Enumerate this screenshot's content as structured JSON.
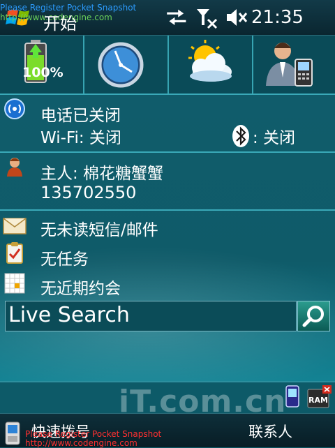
{
  "topbar": {
    "start_label": "开始",
    "time": "21:35",
    "watermark_line1": "Please Register Pocket Snapshot",
    "watermark_line2": "http://www.codengine.com"
  },
  "tiles": [
    {
      "name": "battery",
      "text": "100%"
    },
    {
      "name": "clock-app"
    },
    {
      "name": "weather"
    },
    {
      "name": "contacts"
    }
  ],
  "rows": {
    "phone_status": "电话已关闭",
    "wifi_status": "Wi-Fi: 关闭",
    "bluetooth_status": ": 关闭",
    "owner_name": "主人: 棉花糖蟹蟹",
    "owner_number": "135702550",
    "messages": "无未读短信/邮件",
    "tasks": "无任务",
    "appointments": "无近期约会"
  },
  "search": {
    "value": "Live Search"
  },
  "watermark_center": "iT.com.cn",
  "tray_icons": [
    "phone-status-icon",
    "ram-icon"
  ],
  "softkeys": {
    "left": "快速拨号",
    "right": "联系人"
  },
  "colors": {
    "accent": "#37a4b2",
    "background": "#0f5b69"
  }
}
